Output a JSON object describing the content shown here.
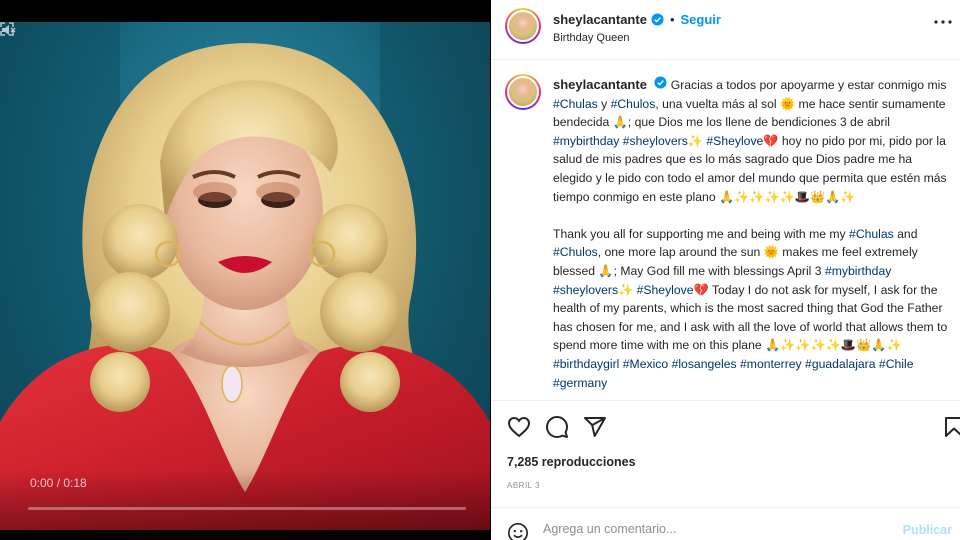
{
  "post": {
    "username": "sheylacantante",
    "follow_label": "Seguir",
    "subtitle": "Birthday Queen",
    "separator": "•"
  },
  "video": {
    "time": "0:00 / 0:18",
    "progress": 0.0
  },
  "caption": {
    "username": "sheylacantante",
    "p1": [
      {
        "t": "Gracias a todos por apoyarme y estar conmigo mis "
      },
      {
        "tag": "#Chulas"
      },
      {
        "t": " y "
      },
      {
        "tag": "#Chulos"
      },
      {
        "t": ", una vuelta más al sol "
      },
      {
        "emoji": "🌞"
      },
      {
        "t": " me hace sentir sumamente bendecida "
      },
      {
        "emoji": "🙏"
      },
      {
        "t": "; que Dios me los llene de bendiciones 3 de abril "
      },
      {
        "tag": "#mybirthday"
      },
      {
        "t": " "
      },
      {
        "tag": "#sheylovers"
      },
      {
        "emoji": "✨"
      },
      {
        "t": " "
      },
      {
        "tag": "#Sheylove"
      },
      {
        "emoji": "💔"
      },
      {
        "t": " hoy no pido por mi, pido por la salud de mis padres que es lo más sagrado que Dios padre me ha elegido y le pido con todo el amor del mundo que permita que estén más tiempo conmigo en este plano "
      },
      {
        "emoji": "🙏✨✨✨✨🎩👑🙏✨"
      }
    ],
    "p2": [
      {
        "t": "Thank you all for supporting me and being with me my "
      },
      {
        "tag": "#Chulas"
      },
      {
        "t": " and "
      },
      {
        "tag": "#Chulos"
      },
      {
        "t": ", one more lap around the sun "
      },
      {
        "emoji": "🌞"
      },
      {
        "t": " makes me feel extremely blessed "
      },
      {
        "emoji": "🙏"
      },
      {
        "t": "; May God fill me with blessings April 3 "
      },
      {
        "tag": "#mybirthday"
      },
      {
        "t": " "
      },
      {
        "tag": "#sheylovers"
      },
      {
        "emoji": "✨"
      },
      {
        "t": " "
      },
      {
        "tag": "#Sheylove"
      },
      {
        "emoji": "💔"
      },
      {
        "t": " Today I do not ask for myself, I ask for the health of my parents, which is the most sacred thing that God the Father has chosen for me, and I ask with all the love of world that allows them to spend more time with me on this plane "
      },
      {
        "emoji": "🙏✨✨✨✨🎩👑🙏✨"
      },
      {
        "t": " "
      },
      {
        "tag": "#birthdaygirl"
      },
      {
        "t": " "
      },
      {
        "tag": "#Mexico"
      },
      {
        "t": " "
      },
      {
        "tag": "#losangeles"
      },
      {
        "t": " "
      },
      {
        "tag": "#monterrey"
      },
      {
        "t": " "
      },
      {
        "tag": "#guadalajara"
      },
      {
        "t": " "
      },
      {
        "tag": "#Chile"
      },
      {
        "t": " "
      },
      {
        "tag": "#germany"
      }
    ]
  },
  "stats": {
    "views": "7,285 reproducciones",
    "date": "ABRIL 3"
  },
  "comment": {
    "placeholder": "Agrega un comentario...",
    "publish_label": "Publicar"
  },
  "icons": {
    "like": "heart-icon",
    "comment": "comment-icon",
    "share": "share-icon",
    "save": "bookmark-icon",
    "emoji": "smile-icon",
    "verified": "verified-badge-icon",
    "more": "more-options-icon"
  },
  "colors": {
    "link": "#0095f6",
    "hashtag": "#00376b",
    "publish_disabled": "#b2dffc",
    "verified": "#0095f6"
  }
}
